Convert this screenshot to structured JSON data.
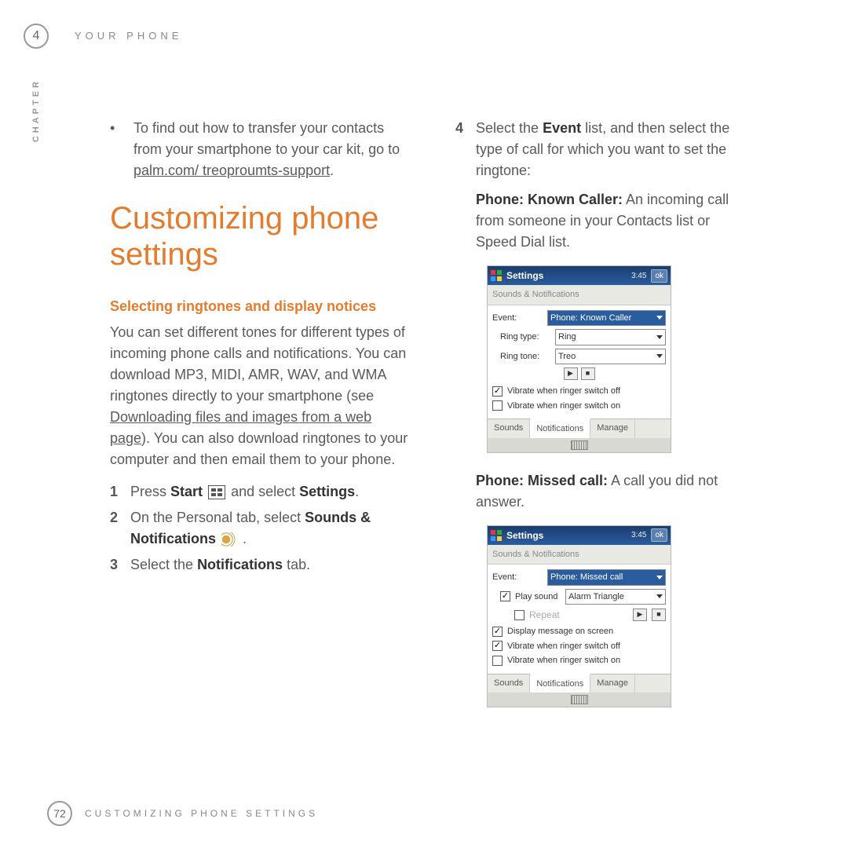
{
  "chapter_number": "4",
  "header": "YOUR PHONE",
  "side_label": "CHAPTER",
  "left": {
    "bullet_pre": "To find out how to transfer your contacts from your smartphone to your car kit, go to ",
    "bullet_link": "palm.com/ treoproumts-support",
    "bullet_post": ".",
    "h1": "Customizing phone settings",
    "h2": "Selecting ringtones and display notices",
    "intro_pre": "You can set different tones for different types of incoming phone calls and notifications. You can download MP3, MIDI, AMR, WAV, and WMA ringtones directly to your smartphone (see ",
    "intro_link": "Downloading files and images from a web page",
    "intro_post": "). You can also download ringtones to your computer and then email them to your phone.",
    "steps": {
      "n1": "1",
      "s1a": "Press ",
      "s1b": "Start",
      "s1c": " and select ",
      "s1d": "Settings",
      "s1e": ".",
      "n2": "2",
      "s2a": "On the Personal tab, select ",
      "s2b": "Sounds & Notifications",
      "s2c": ".",
      "n3": "3",
      "s3a": "Select the ",
      "s3b": "Notifications",
      "s3c": " tab."
    }
  },
  "right": {
    "step4_num": "4",
    "step4a": "Select the ",
    "step4b": "Event",
    "step4c": " list, and then select the type of call for which you want to set the ringtone:",
    "known_label": "Phone: Known Caller:",
    "known_text": " An incoming call from someone in your Contacts list or Speed Dial list.",
    "missed_label": "Phone: Missed call:",
    "missed_text": " A call you did not answer."
  },
  "mock_common": {
    "title": "Settings",
    "time": "3:45",
    "ok": "ok",
    "subtitle": "Sounds & Notifications",
    "tabs": {
      "sounds": "Sounds",
      "notifications": "Notifications",
      "manage": "Manage"
    },
    "event_label": "Event:",
    "vib_off": "Vibrate when ringer switch off",
    "vib_on": "Vibrate when ringer switch on"
  },
  "mock1": {
    "event_value": "Phone: Known Caller",
    "ring_type_label": "Ring type:",
    "ring_type_value": "Ring",
    "ring_tone_label": "Ring tone:",
    "ring_tone_value": "Treo"
  },
  "mock2": {
    "event_value": "Phone: Missed call",
    "play_sound": "Play sound",
    "sound_value": "Alarm Triangle",
    "repeat": "Repeat",
    "display_msg": "Display message on screen"
  },
  "footer": {
    "page": "72",
    "label": "CUSTOMIZING PHONE SETTINGS"
  }
}
